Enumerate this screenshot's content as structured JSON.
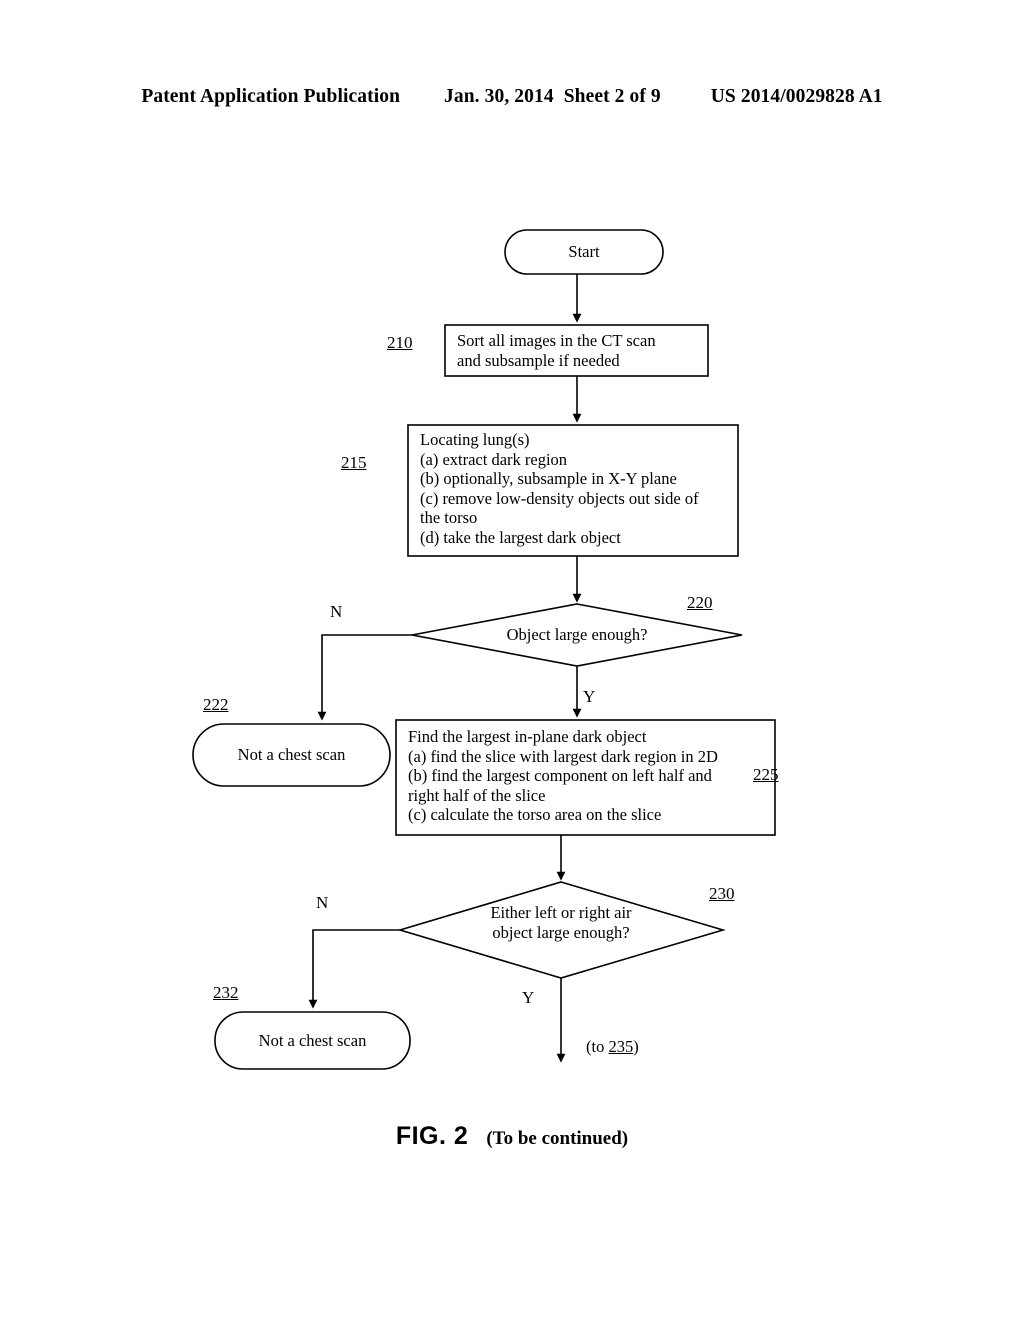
{
  "header": {
    "publication": "Patent Application Publication",
    "date": "Jan. 30, 2014",
    "sheet": "Sheet 2 of 9",
    "patent_number": "US 2014/0029828 A1"
  },
  "figure": {
    "label": "FIG. 2",
    "note": "(To be continued)"
  },
  "flowchart": {
    "nodes": {
      "start": {
        "ref": "",
        "shape": "terminal",
        "text": "Start"
      },
      "n210": {
        "ref": "210",
        "shape": "process",
        "text": "Sort all images in the CT scan\nand subsample if needed"
      },
      "n215": {
        "ref": "215",
        "shape": "process",
        "text": "Locating lung(s)\n(a) extract dark region\n(b) optionally, subsample in X-Y plane\n(c) remove low-density objects out side of\nthe torso\n(d) take the largest dark object"
      },
      "n220": {
        "ref": "220",
        "shape": "decision",
        "text": "Object large enough?"
      },
      "n222": {
        "ref": "222",
        "shape": "terminal",
        "text": "Not a chest scan"
      },
      "n225": {
        "ref": "225",
        "shape": "process",
        "text": "Find the largest in-plane dark object\n(a) find the slice with largest dark region in 2D\n(b) find the largest component on left half and\nright half of the slice\n(c) calculate the torso area on the slice"
      },
      "n230": {
        "ref": "230",
        "shape": "decision",
        "text": "Either left or right air\nobject large enough?"
      },
      "n232": {
        "ref": "232",
        "shape": "terminal",
        "text": "Not a chest scan"
      }
    },
    "branch_labels": {
      "n220_no": "N",
      "n220_yes": "Y",
      "n230_no": "N",
      "n230_yes": "Y"
    },
    "continuation": {
      "prefix": "(to ",
      "ref": "235",
      "suffix": ")"
    },
    "colors": {
      "line": "#000000",
      "background": "#ffffff",
      "text": "#000000"
    }
  }
}
